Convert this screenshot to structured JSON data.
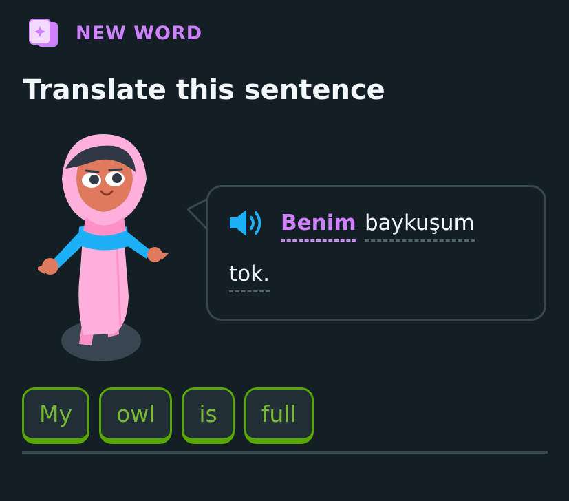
{
  "header": {
    "badge_label": "NEW WORD",
    "badge_icon": "new-word-card-icon",
    "title": "Translate this sentence"
  },
  "prompt": {
    "speaker_icon": "speaker-icon",
    "words": [
      {
        "text": "Benim",
        "status": "new"
      },
      {
        "text": "baykuşum",
        "status": "hint"
      },
      {
        "text": "tok.",
        "status": "hint"
      }
    ]
  },
  "answer": {
    "chips": [
      "My",
      "owl",
      "is",
      "full"
    ]
  },
  "colors": {
    "background": "#131f24",
    "accent_purple": "#ce82ff",
    "chip_green": "#58a700",
    "speaker_blue": "#1cb0f6",
    "border": "#37464f"
  }
}
